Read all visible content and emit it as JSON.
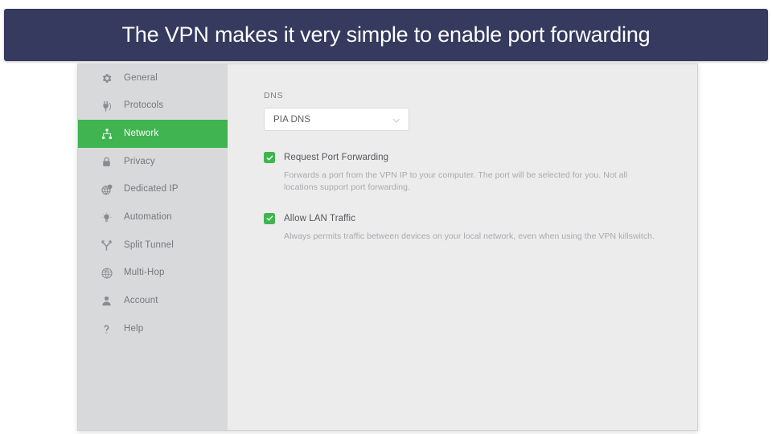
{
  "banner": {
    "text": "The VPN makes it very simple to enable port forwarding",
    "background_color": "#353a5e",
    "text_color": "#ffffff"
  },
  "app": {
    "accent_color": "#3fb450",
    "sidebar_background": "#d8d9db",
    "content_background": "#ececec"
  },
  "sidebar": {
    "items": [
      {
        "label": "General",
        "icon": "gear-icon",
        "active": false
      },
      {
        "label": "Protocols",
        "icon": "plug-icon",
        "active": false
      },
      {
        "label": "Network",
        "icon": "network-icon",
        "active": true
      },
      {
        "label": "Privacy",
        "icon": "lock-icon",
        "active": false
      },
      {
        "label": "Dedicated IP",
        "icon": "dedicated-ip-icon",
        "active": false
      },
      {
        "label": "Automation",
        "icon": "lightbulb-icon",
        "active": false
      },
      {
        "label": "Split Tunnel",
        "icon": "split-tunnel-icon",
        "active": false
      },
      {
        "label": "Multi-Hop",
        "icon": "globe-icon",
        "active": false
      },
      {
        "label": "Account",
        "icon": "person-icon",
        "active": false
      },
      {
        "label": "Help",
        "icon": "question-icon",
        "active": false
      }
    ]
  },
  "main": {
    "dns": {
      "label": "DNS",
      "selected": "PIA DNS",
      "chevron_icon": "chevron-down-icon"
    },
    "options": [
      {
        "title": "Request Port Forwarding",
        "description": "Forwards a port from the VPN IP to your computer. The port will be selected for you. Not all locations support port forwarding.",
        "checked": true,
        "check_icon": "checkmark-icon"
      },
      {
        "title": "Allow LAN Traffic",
        "description": "Always permits traffic between devices on your local network, even when using the VPN killswitch.",
        "checked": true,
        "check_icon": "checkmark-icon"
      }
    ]
  }
}
